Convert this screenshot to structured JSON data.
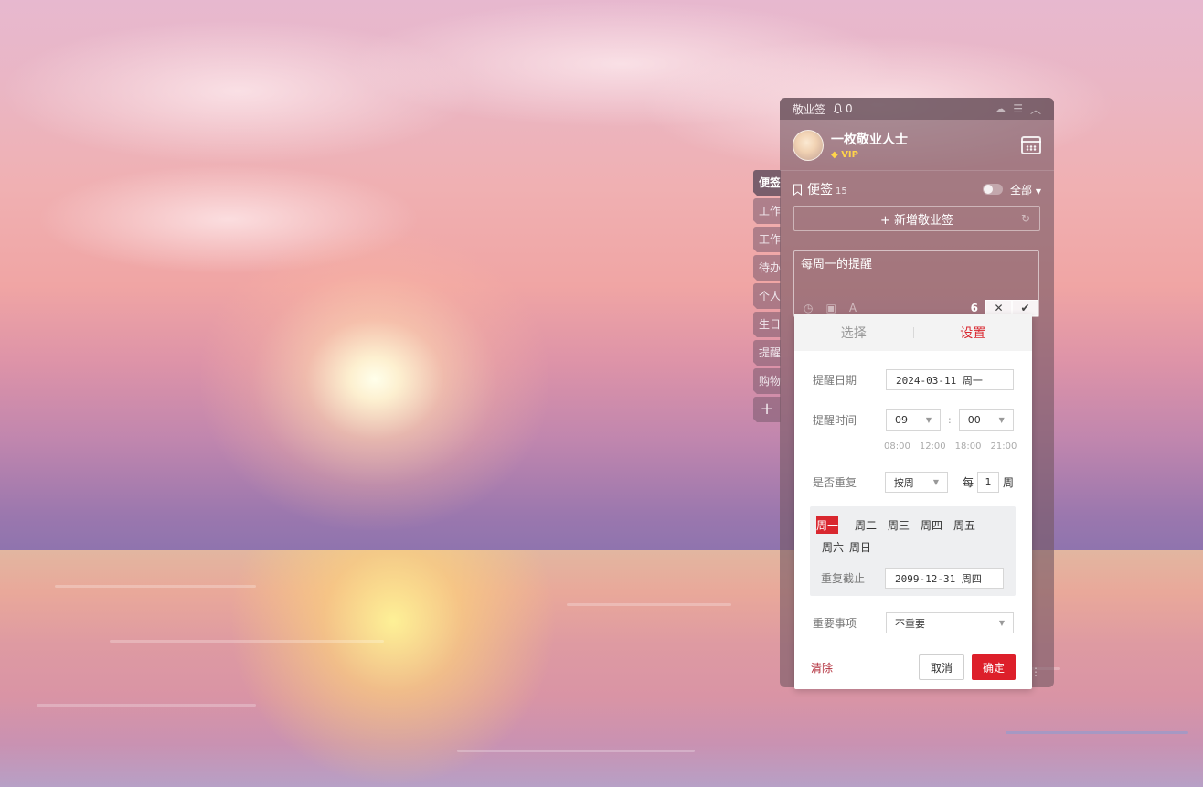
{
  "widget": {
    "title": "敬业签",
    "notification_count": "0",
    "user": {
      "name": "一枚敬业人士",
      "badge": "VIP"
    },
    "notes": {
      "label": "便签",
      "count": "15",
      "filter": "全部"
    },
    "add_note_label": "+ 新增敬业签",
    "editing_note": {
      "text": "每周一的提醒",
      "count": "6"
    }
  },
  "side_tabs": [
    "便签",
    "工作",
    "工作",
    "待办",
    "个人",
    "生日",
    "提醒",
    "购物",
    "+"
  ],
  "popup": {
    "tabs": [
      "选择",
      "设置"
    ],
    "active_tab": "设置",
    "date_label": "提醒日期",
    "date_value": "2024-03-11 周一",
    "time_label": "提醒时间",
    "hour": "09",
    "minute": "00",
    "colon": ":",
    "quick_times": [
      "08:00",
      "12:00",
      "18:00",
      "21:00"
    ],
    "repeat_label": "是否重复",
    "repeat_value": "按周",
    "every_prefix": "每",
    "every_num": "1",
    "every_unit": "周",
    "days": [
      "周一",
      "周二",
      "周三",
      "周四",
      "周五",
      "周六",
      "周日"
    ],
    "selected_day": "周一",
    "until_label": "重复截止",
    "until_value": "2099-12-31 周四",
    "importance_label": "重要事项",
    "importance_value": "不重要",
    "clear_label": "清除",
    "cancel_label": "取消",
    "ok_label": "确定"
  },
  "colors": {
    "accent": "#d9272f",
    "ok_button": "#dd1f2a",
    "vip": "#ffd54a"
  }
}
